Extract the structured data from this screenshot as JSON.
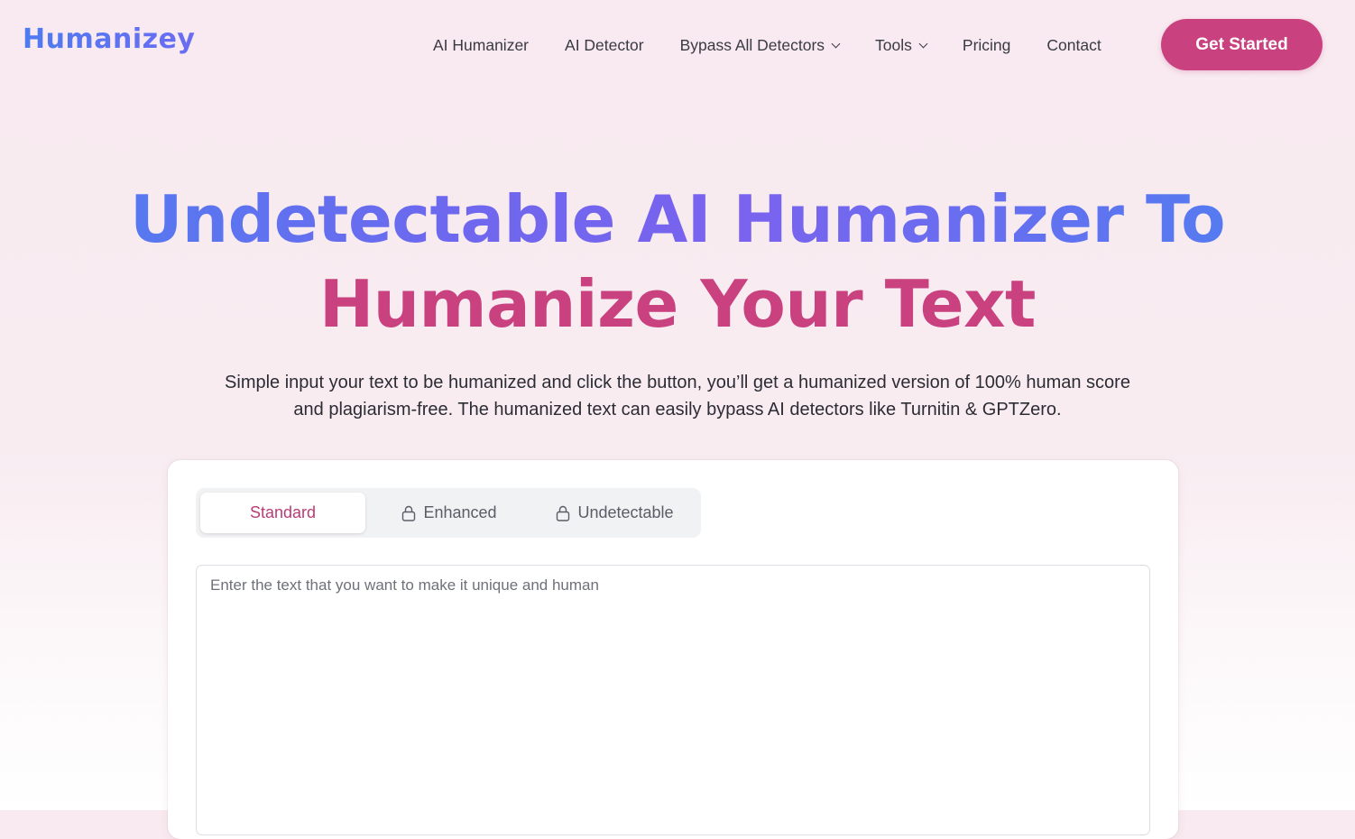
{
  "brand": {
    "name": "Humanizey",
    "logo_color": "#5b7cf0"
  },
  "nav": {
    "items": [
      {
        "label": "AI Humanizer",
        "has_dropdown": false
      },
      {
        "label": "AI Detector",
        "has_dropdown": false
      },
      {
        "label": "Bypass All Detectors",
        "has_dropdown": true
      },
      {
        "label": "Tools",
        "has_dropdown": true
      },
      {
        "label": "Pricing",
        "has_dropdown": false
      },
      {
        "label": "Contact",
        "has_dropdown": false
      }
    ],
    "cta_label": "Get Started",
    "cta_color": "#c9417f"
  },
  "hero": {
    "title_line1": "Undetectable AI Humanizer To",
    "title_line2": "Humanize Your Text",
    "title_line1_color": "#5b7cf0",
    "title_line2_color": "#c9417f",
    "subtitle": "Simple input your text to be humanized and click the button, you’ll get a humanized version of 100% human score and plagiarism-free. The humanized text can easily bypass AI detectors like Turnitin & GPTZero."
  },
  "editor": {
    "tabs": [
      {
        "label": "Standard",
        "locked": false,
        "active": true
      },
      {
        "label": "Enhanced",
        "locked": true,
        "active": false
      },
      {
        "label": "Undetectable",
        "locked": true,
        "active": false
      }
    ],
    "input_value": "",
    "input_placeholder": "Enter the text that you want to make it unique and human",
    "active_tab_color": "#b83d76"
  }
}
